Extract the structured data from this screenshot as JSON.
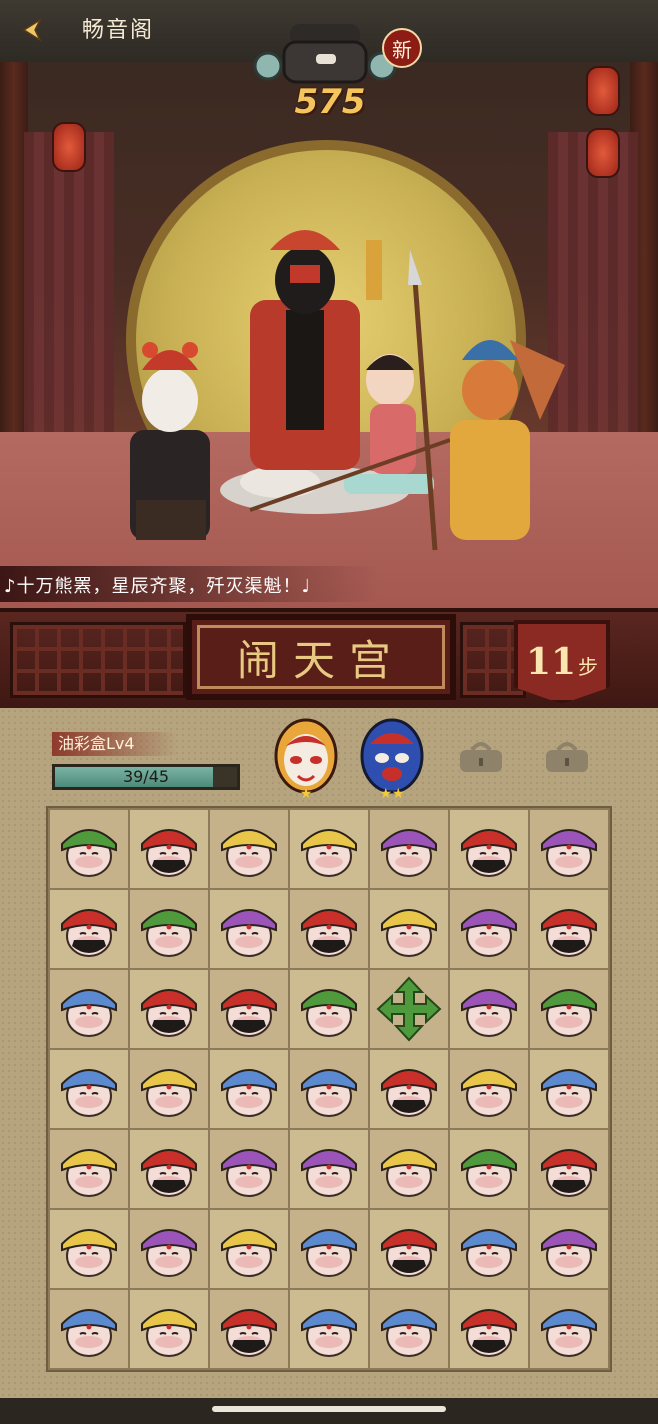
{
  "header": {
    "location_title": "畅音阁",
    "new_badge": "新",
    "score": "575"
  },
  "lyric": "♪十万熊罴，星辰齐聚，歼灭渠魁！♩",
  "level": {
    "name": "闹天宫",
    "steps_count": "11",
    "steps_unit": "步"
  },
  "item": {
    "name": "油彩盒Lv4",
    "progress_text": "39/45",
    "progress_fraction": 0.8667
  },
  "goals": [
    {
      "icon": "monkey-king-mask-icon",
      "stars": 1
    },
    {
      "icon": "blue-opera-mask-icon",
      "stars": 2
    }
  ],
  "locked_slots": [
    "padlock-icon",
    "padlock-icon"
  ],
  "tile_colors": {
    "green": "#4f9a3c",
    "red": "#c9302a",
    "yellow": "#e8c64a",
    "purple": "#9b55b8",
    "blue": "#5b8ad0"
  },
  "board": [
    [
      "green",
      "red",
      "yellow",
      "yellow",
      "purple",
      "red",
      "purple"
    ],
    [
      "red",
      "green",
      "purple",
      "red",
      "yellow",
      "purple",
      "red"
    ],
    [
      "blue",
      "red",
      "red",
      "green",
      "arrow",
      "purple",
      "green"
    ],
    [
      "blue",
      "yellow",
      "blue",
      "blue",
      "red",
      "yellow",
      "blue"
    ],
    [
      "yellow",
      "red",
      "purple",
      "purple",
      "yellow",
      "green",
      "red"
    ],
    [
      "yellow",
      "purple",
      "yellow",
      "blue",
      "red",
      "blue",
      "purple"
    ],
    [
      "blue",
      "yellow",
      "red",
      "blue",
      "blue",
      "red",
      "blue"
    ]
  ]
}
